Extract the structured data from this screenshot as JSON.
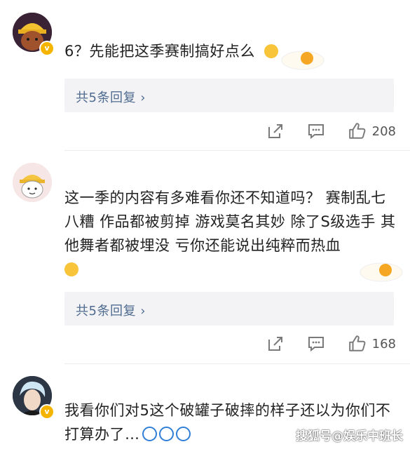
{
  "comments": [
    {
      "text": "6？先能把这季赛制搞好点么",
      "reply_link": "共5条回复",
      "like_count": "208"
    },
    {
      "text": "这一季的内容有多难看你还不知道吗？ 赛制乱七八糟 作品都被剪掉 游戏莫名其妙 除了S级选手 其他舞者都被埋没 亏你还能说出纯粹而热血",
      "reply_link": "共5条回复",
      "like_count": "168"
    },
    {
      "text": "我看你们对5这个破罐子破摔的样子还以为你们不打算办了…"
    }
  ],
  "watermark": "搜狐号@娱乐中班长",
  "colors": {
    "link": "#4f6b8f",
    "reply_bg": "#f3f3f5",
    "badge": "#f5b400",
    "icon": "#7a7a7a"
  }
}
